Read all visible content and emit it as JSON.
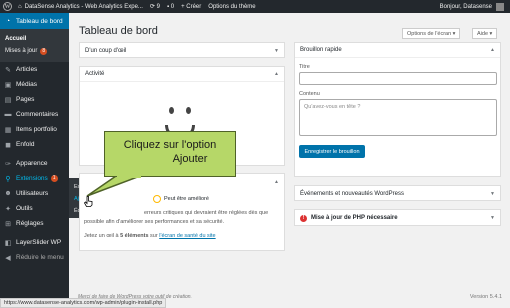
{
  "adminbar": {
    "site_name": "DataSense Analytics - Web Analytics Expe...",
    "updates_count": "9",
    "comments_count": "0",
    "new_label": "+ Créer",
    "theme_options": "Options du thème",
    "greeting": "Bonjour, Datasense"
  },
  "sidebar": {
    "dashboard": "Tableau de bord",
    "home": "Accueil",
    "updates": "Mises à jour",
    "updates_badge": "8",
    "items": [
      {
        "label": "Articles",
        "icon": "pin-icon",
        "glyph": "✎"
      },
      {
        "label": "Médias",
        "icon": "media-icon",
        "glyph": "▣"
      },
      {
        "label": "Pages",
        "icon": "pages-icon",
        "glyph": "▤"
      },
      {
        "label": "Commentaires",
        "icon": "comments-icon",
        "glyph": "▬"
      },
      {
        "label": "Items portfolio",
        "icon": "portfolio-icon",
        "glyph": "▦"
      },
      {
        "label": "Enfold",
        "icon": "enfold-icon",
        "glyph": "◼"
      }
    ],
    "appearance": "Apparence",
    "extensions": "Extensions",
    "extensions_badge": "1",
    "users": "Utilisateurs",
    "tools": "Outils",
    "settings": "Réglages",
    "layerslider": "LayerSlider WP",
    "collapse": "Réduire le menu"
  },
  "flyout": {
    "installed": "Extensions install...",
    "add": "Ajouter",
    "editor": "Éditeur d'extension"
  },
  "main": {
    "title": "Tableau de bord",
    "screen_options": "Options de l'écran ▾",
    "help": "Aide ▾",
    "at_a_glance": "D'un coup d'œil",
    "activity": "Activité",
    "health_status": "Peut être amélioré",
    "health_text_1": "erreurs critiques qui devraient être réglées dès que",
    "health_text_2": "possible afin d'améliorer ses performances et sa sécurité.",
    "health_text_3": "Jetez un œil à ",
    "health_count": "5 éléments",
    "health_text_4": " sur ",
    "health_link": "l'écran de santé du site",
    "quick_draft": "Brouillon rapide",
    "title_label": "Titre",
    "content_label": "Contenu",
    "content_placeholder": "Qu'avez-vous en tête ?",
    "save_draft": "Enregistrer le brouillon",
    "events": "Événements et nouveautés WordPress",
    "php_update": "Mise à jour de PHP nécessaire",
    "footer_left": "Merci de faire de WordPress votre outil de création.",
    "version": "Version 5.4.1"
  },
  "callout": {
    "line1": "Cliquez sur l'option",
    "line2": "Ajouter"
  },
  "statusbar": {
    "url": "https://www.datasense-analytics.com/wp-admin/plugin-install.php"
  }
}
